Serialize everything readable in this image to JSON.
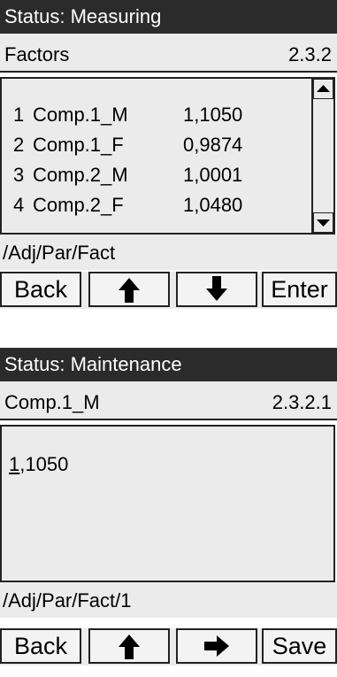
{
  "screen1": {
    "status": "Status: Measuring",
    "menu_title": "Factors",
    "menu_number": "2.3.2",
    "rows": [
      {
        "index": "1",
        "name": "Comp.1_M",
        "value": "1,1050"
      },
      {
        "index": "2",
        "name": "Comp.1_F",
        "value": "0,9874"
      },
      {
        "index": "3",
        "name": "Comp.2_M",
        "value": "1,0001"
      },
      {
        "index": "4",
        "name": "Comp.2_F",
        "value": "1,0480"
      }
    ],
    "path": "/Adj/Par/Fact",
    "buttons": {
      "back": "Back",
      "up_icon": "arrow-up-icon",
      "down_icon": "arrow-down-icon",
      "enter": "Enter"
    }
  },
  "screen2": {
    "status": "Status: Maintenance",
    "menu_title": "Comp.1_M",
    "menu_number": "2.3.2.1",
    "value_cursor_digit": "1",
    "value_rest": ",1050",
    "path": "/Adj/Par/Fact/1",
    "buttons": {
      "back": "Back",
      "up_icon": "arrow-up-icon",
      "right_icon": "arrow-right-icon",
      "save": "Save"
    }
  },
  "colors": {
    "status_bg": "#2b2b2b",
    "panel_bg": "#ebebeb",
    "border": "#222222"
  }
}
